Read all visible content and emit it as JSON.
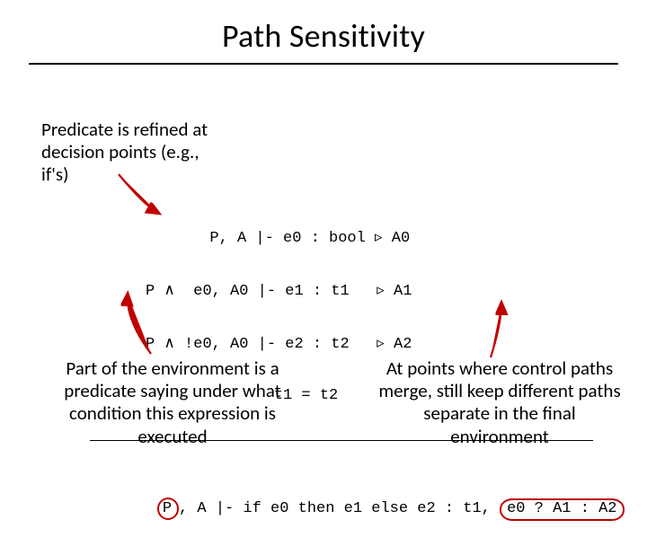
{
  "title": "Path Sensitivity",
  "notes": {
    "top": "Predicate is refined at decision points (e.g., if's)",
    "bottom_left": "Part of the environment is a predicate saying under what condition this expression is executed",
    "bottom_right": "At points where control paths merge, still keep different paths separate in the final environment"
  },
  "rule": {
    "premise1": "       P, A |- e0 : bool ▹ A0",
    "premise2": "P ∧  e0, A0 |- e1 : t1   ▹ A1",
    "premise3": "P ∧ !e0, A0 |- e2 : t2   ▹ A2",
    "premise4": "              t1 = t2",
    "conclusion_pre": ", A |- if e0 then e1 else e2 : t1, ",
    "conclusion_P": "P",
    "conclusion_tern": "e0 ? A1 : A2"
  }
}
